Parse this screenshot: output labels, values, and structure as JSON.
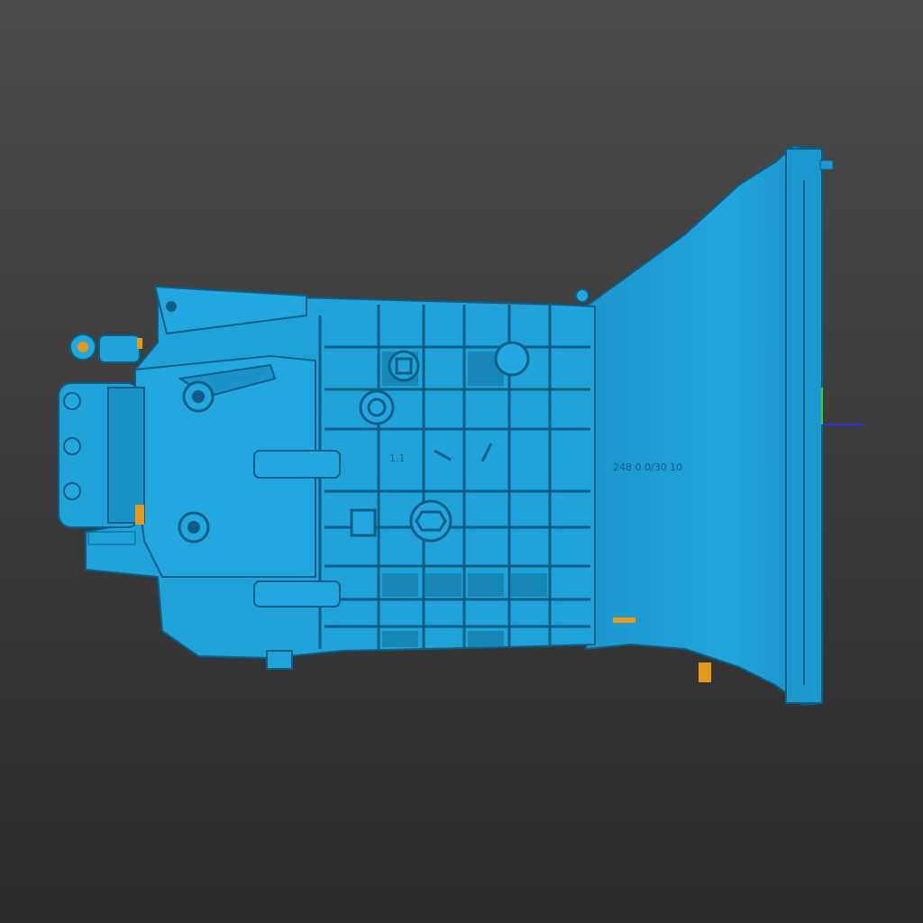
{
  "viewport": {
    "background_top": "#4a4a4a",
    "background_bottom": "#2c2c2c"
  },
  "model": {
    "color": "#1fa3d8",
    "shadow_color": "#0b5f86",
    "highlight_color": "#46c2ee",
    "underside_color": "#e59a1c",
    "cast_markings": [
      "1.1",
      "248 0 0/30 10"
    ]
  },
  "axis_gizmo": {
    "icon": "xyz-axis-gizmo-icon",
    "x_color": "#2f2fe0",
    "y_color": "#2fd22f"
  }
}
